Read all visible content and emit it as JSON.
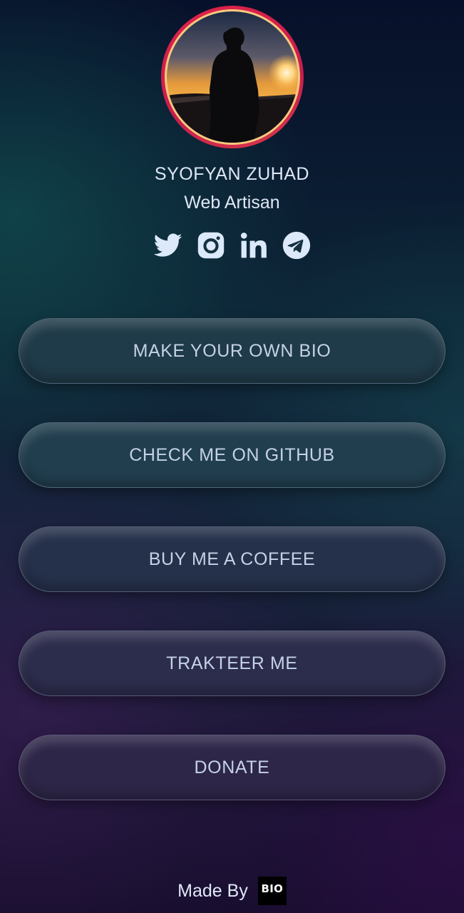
{
  "profile": {
    "name": "SYOFYAN ZUHAD",
    "role": "Web Artisan"
  },
  "socials": [
    {
      "name": "twitter-icon",
      "color": "#dbe9fb"
    },
    {
      "name": "instagram-icon",
      "color": "#dbe9fb"
    },
    {
      "name": "linkedin-icon",
      "color": "#dbe9fb"
    },
    {
      "name": "telegram-icon",
      "color": "#dbe9fb"
    }
  ],
  "links": [
    {
      "label": "MAKE YOUR OWN BIO",
      "color": "#1f3a48"
    },
    {
      "label": "CHECK ME ON GITHUB",
      "color": "#213e4e"
    },
    {
      "label": "BUY ME A COFFEE",
      "color": "#25304a"
    },
    {
      "label": "TRAKTEER ME",
      "color": "#2c2c4c"
    },
    {
      "label": "DONATE",
      "color": "#2e2648"
    }
  ],
  "footer": {
    "made_by": "Made By",
    "logo_text": "BIO"
  }
}
